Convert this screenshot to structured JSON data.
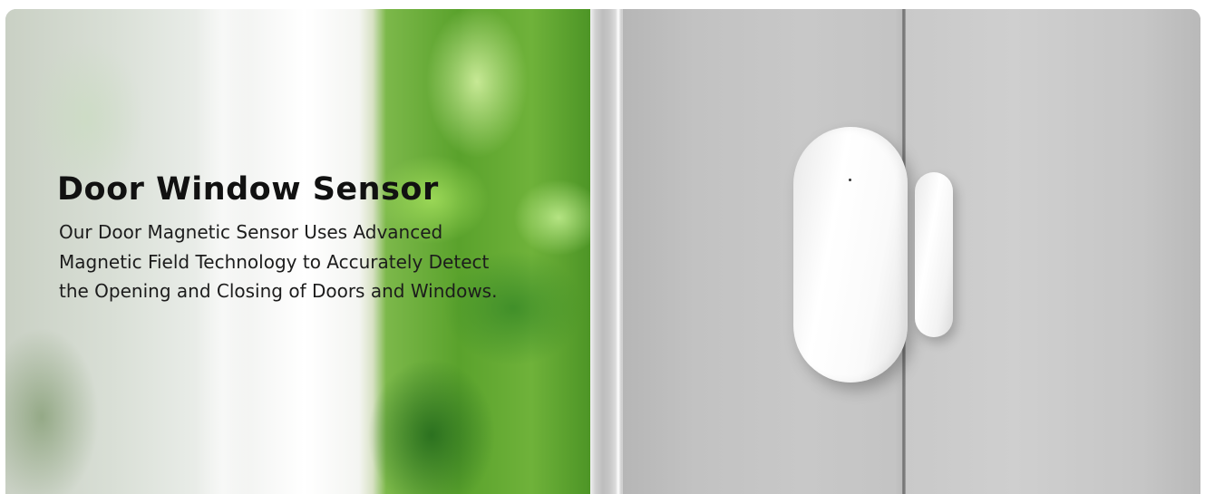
{
  "banner": {
    "title": "Door Window Sensor",
    "description": "Our Door Magnetic Sensor Uses Advanced Magnetic Field Technology to Accurately Detect the Opening and Closing of Doors and Windows."
  },
  "colors": {
    "title_text": "#111111",
    "body_text": "#1c1c1c",
    "sensor_white": "#ffffff",
    "door_gray": "#c4c4c4",
    "foliage_green": "#5aa22c"
  },
  "icons": {
    "product": "door-window-sensor-image"
  }
}
